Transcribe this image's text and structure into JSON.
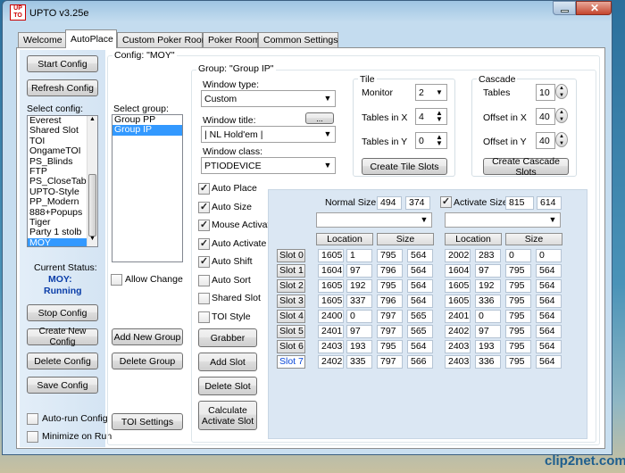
{
  "window": {
    "title": "UPTO  v3.25e",
    "logo_letters": [
      "U",
      "P",
      "T",
      "O"
    ]
  },
  "tabs": [
    "Welcome",
    "AutoPlace",
    "Custom Poker Room",
    "Poker Room",
    "Common Settings"
  ],
  "left": {
    "start_config": "Start Config",
    "refresh_config": "Refresh Config",
    "select_config_label": "Select config:",
    "configs": [
      "Everest",
      "Shared Slot",
      "TOI",
      "OngameTOI",
      "PS_Blinds",
      "FTP",
      "PS_CloseTable",
      "UPTO-Style",
      "PP_Modern",
      "888+Popups",
      "Tiger",
      "Party 1 stolb",
      "MOY"
    ],
    "current_status_label": "Current Status:",
    "status_config": "MOY:",
    "status_state": "Running",
    "stop_config": "Stop Config",
    "create_new_config": "Create New Config",
    "delete_config": "Delete Config",
    "save_config": "Save Config",
    "autorun_config": "Auto-run Config",
    "minimize_on_run": "Minimize on Run"
  },
  "config_caption": "Config: \"MOY\"",
  "groups": {
    "select_group_label": "Select group:",
    "items": [
      "Group PP",
      "Group IP"
    ],
    "allow_change": "Allow Change",
    "add_new_group": "Add New Group",
    "delete_group": "Delete Group",
    "toi_settings": "TOI Settings"
  },
  "group_caption": "Group: \"Group IP\"",
  "window_type": {
    "label": "Window type:",
    "value": "Custom"
  },
  "window_title": {
    "label": "Window title:",
    "ellipsis": "...",
    "value": "| NL Hold'em |"
  },
  "window_class": {
    "label": "Window class:",
    "value": "PTIODEVICE"
  },
  "tile": {
    "label": "Tile",
    "monitor_label": "Monitor",
    "monitor": "2",
    "tables_x_label": "Tables in X",
    "tables_x": "4",
    "tables_y_label": "Tables in Y",
    "tables_y": "0",
    "create": "Create Tile Slots"
  },
  "cascade": {
    "label": "Cascade",
    "tables_label": "Tables",
    "tables": "10",
    "offset_x_label": "Offset in X",
    "offset_x": "40",
    "offset_y_label": "Offset in Y",
    "offset_y": "40",
    "create": "Create Cascade Slots"
  },
  "options": [
    {
      "label": "Auto Place",
      "checked": true
    },
    {
      "label": "Auto Size",
      "checked": true
    },
    {
      "label": "Mouse Activate",
      "checked": true
    },
    {
      "label": "Auto Activate",
      "checked": true
    },
    {
      "label": "Auto Shift",
      "checked": true
    },
    {
      "label": "Auto Sort",
      "checked": false
    },
    {
      "label": "Shared Slot",
      "checked": false
    },
    {
      "label": "TOI Style",
      "checked": false
    }
  ],
  "actions": {
    "grabber": "Grabber",
    "add_slot": "Add Slot",
    "delete_slot": "Delete Slot",
    "calc_line1": "Calculate",
    "calc_line2": "Activate Slot"
  },
  "sizes": {
    "normal_label": "Normal Size",
    "normal_w": "494",
    "normal_h": "374",
    "activate_label": "Activate Size",
    "activate_w": "815",
    "activate_h": "614"
  },
  "slot_headers": {
    "location": "Location",
    "size": "Size"
  },
  "slots": [
    {
      "name": "Slot 0",
      "n": [
        "1605",
        "1",
        "795",
        "564"
      ],
      "a": [
        "2002",
        "283",
        "0",
        "0"
      ]
    },
    {
      "name": "Slot 1",
      "n": [
        "1604",
        "97",
        "796",
        "564"
      ],
      "a": [
        "1604",
        "97",
        "795",
        "564"
      ]
    },
    {
      "name": "Slot 2",
      "n": [
        "1605",
        "192",
        "795",
        "564"
      ],
      "a": [
        "1605",
        "192",
        "795",
        "564"
      ]
    },
    {
      "name": "Slot 3",
      "n": [
        "1605",
        "337",
        "796",
        "564"
      ],
      "a": [
        "1605",
        "336",
        "795",
        "564"
      ]
    },
    {
      "name": "Slot 4",
      "n": [
        "2400",
        "0",
        "797",
        "565"
      ],
      "a": [
        "2401",
        "0",
        "795",
        "564"
      ]
    },
    {
      "name": "Slot 5",
      "n": [
        "2401",
        "97",
        "797",
        "565"
      ],
      "a": [
        "2402",
        "97",
        "795",
        "564"
      ]
    },
    {
      "name": "Slot 6",
      "n": [
        "2403",
        "193",
        "795",
        "564"
      ],
      "a": [
        "2403",
        "193",
        "795",
        "564"
      ]
    },
    {
      "name": "Slot 7",
      "n": [
        "2402",
        "335",
        "797",
        "566"
      ],
      "a": [
        "2403",
        "336",
        "795",
        "564"
      ]
    }
  ],
  "selected_slot": 7,
  "watermark": "clip2net.com"
}
